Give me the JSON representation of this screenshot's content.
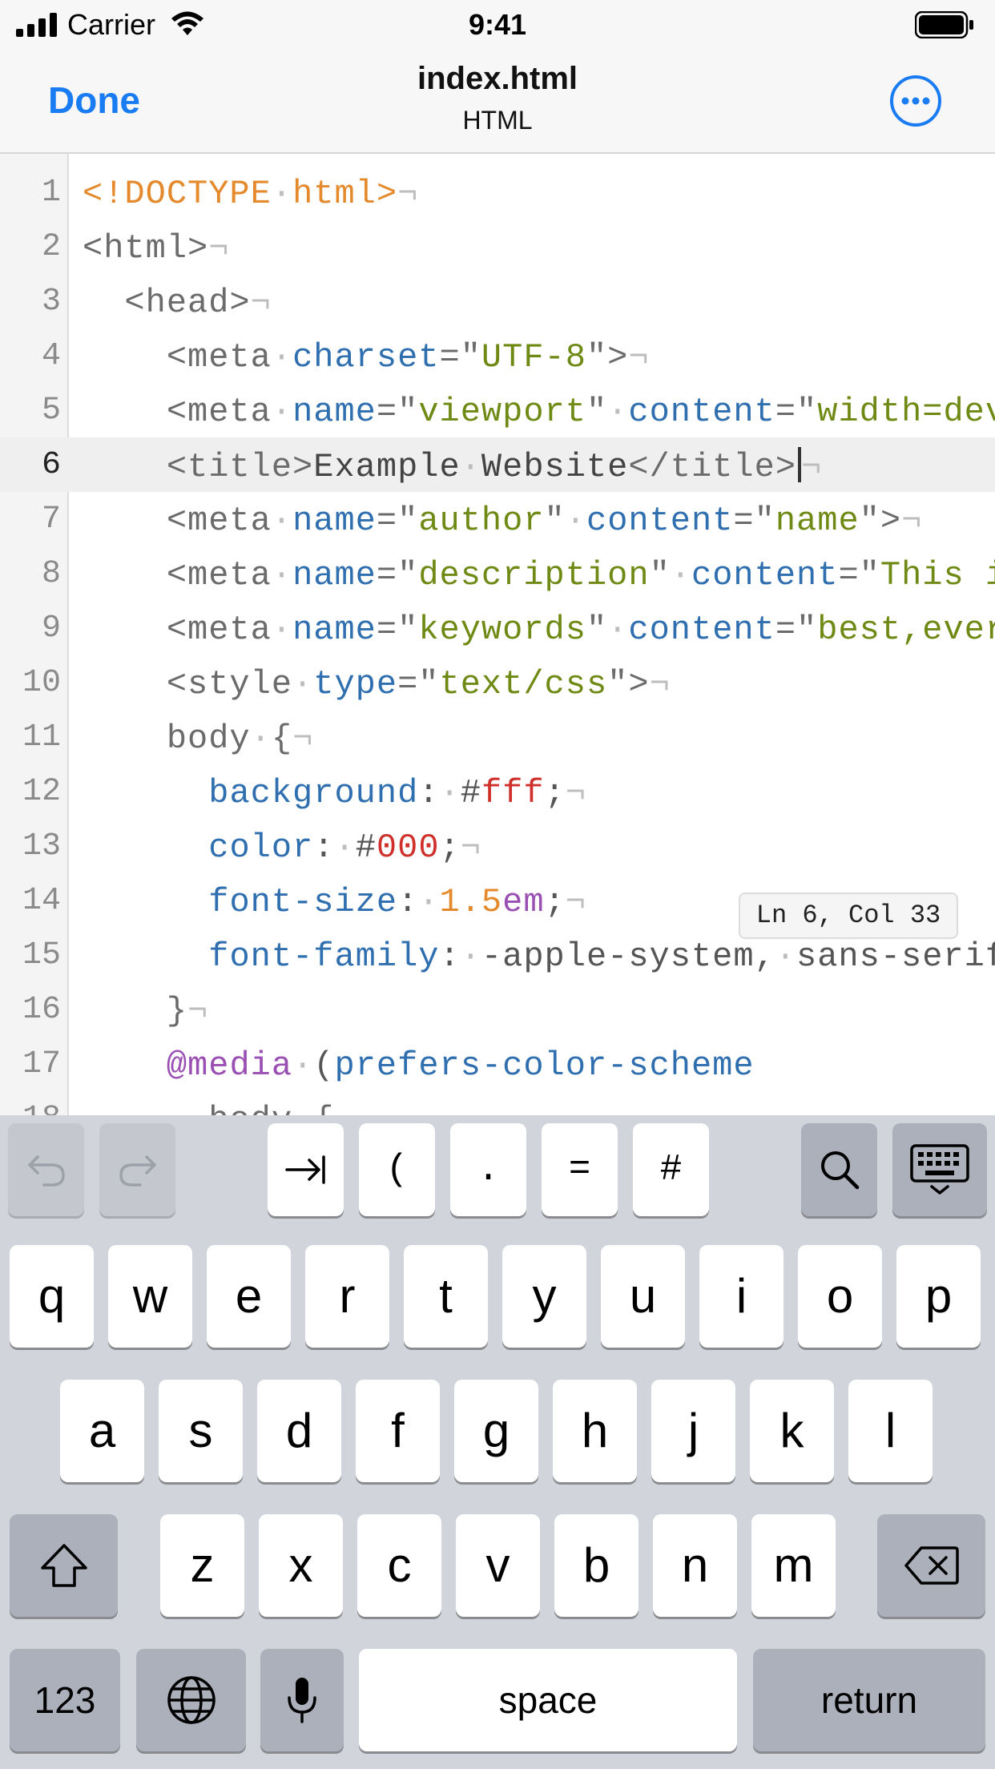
{
  "status_bar": {
    "carrier": "Carrier",
    "time": "9:41"
  },
  "nav": {
    "done_label": "Done",
    "title": "index.html",
    "subtitle": "HTML",
    "accent": "#1a7cf2"
  },
  "editor": {
    "current_line": 6,
    "line_numbers": [
      "1",
      "2",
      "3",
      "4",
      "5",
      "6",
      "7",
      "8",
      "9",
      "10",
      "11",
      "12",
      "13",
      "14",
      "15",
      "16",
      "17",
      "18"
    ],
    "position": "Ln 6, Col 33",
    "lines": [
      [
        [
          "doc",
          "<!DOCTYPE"
        ],
        [
          "inv",
          "·"
        ],
        [
          "doc",
          "html>"
        ],
        [
          "inv",
          "¬"
        ]
      ],
      [
        [
          "tag",
          "<html>"
        ],
        [
          "inv",
          "¬"
        ]
      ],
      [
        [
          "tag",
          "  <head>"
        ],
        [
          "inv",
          "¬"
        ]
      ],
      [
        [
          "tag",
          "    <meta"
        ],
        [
          "inv",
          "·"
        ],
        [
          "attr",
          "charset"
        ],
        [
          "tag",
          "=\""
        ],
        [
          "str",
          "UTF-8"
        ],
        [
          "tag",
          "\">"
        ],
        [
          "inv",
          "¬"
        ]
      ],
      [
        [
          "tag",
          "    <meta"
        ],
        [
          "inv",
          "·"
        ],
        [
          "attr",
          "name"
        ],
        [
          "tag",
          "=\""
        ],
        [
          "str",
          "viewport"
        ],
        [
          "tag",
          "\""
        ],
        [
          "inv",
          "·"
        ],
        [
          "attr",
          "content"
        ],
        [
          "tag",
          "=\""
        ],
        [
          "str",
          "width=devi"
        ]
      ],
      [
        [
          "tag",
          "    <title>"
        ],
        [
          "txt",
          "Example"
        ],
        [
          "inv",
          "·"
        ],
        [
          "txt",
          "Website"
        ],
        [
          "tag",
          "</title>"
        ],
        [
          "caret",
          ""
        ],
        [
          "inv",
          "¬"
        ]
      ],
      [
        [
          "tag",
          "    <meta"
        ],
        [
          "inv",
          "·"
        ],
        [
          "attr",
          "name"
        ],
        [
          "tag",
          "=\""
        ],
        [
          "str",
          "author"
        ],
        [
          "tag",
          "\""
        ],
        [
          "inv",
          "·"
        ],
        [
          "attr",
          "content"
        ],
        [
          "tag",
          "=\""
        ],
        [
          "str",
          "name"
        ],
        [
          "tag",
          "\">"
        ],
        [
          "inv",
          "¬"
        ]
      ],
      [
        [
          "tag",
          "    <meta"
        ],
        [
          "inv",
          "·"
        ],
        [
          "attr",
          "name"
        ],
        [
          "tag",
          "=\""
        ],
        [
          "str",
          "description"
        ],
        [
          "tag",
          "\""
        ],
        [
          "inv",
          "·"
        ],
        [
          "attr",
          "content"
        ],
        [
          "tag",
          "=\""
        ],
        [
          "str",
          "This is"
        ]
      ],
      [
        [
          "tag",
          "    <meta"
        ],
        [
          "inv",
          "·"
        ],
        [
          "attr",
          "name"
        ],
        [
          "tag",
          "=\""
        ],
        [
          "str",
          "keywords"
        ],
        [
          "tag",
          "\""
        ],
        [
          "inv",
          "·"
        ],
        [
          "attr",
          "content"
        ],
        [
          "tag",
          "=\""
        ],
        [
          "str",
          "best,ever"
        ]
      ],
      [
        [
          "tag",
          "    <style"
        ],
        [
          "inv",
          "·"
        ],
        [
          "attr",
          "type"
        ],
        [
          "tag",
          "=\""
        ],
        [
          "str",
          "text/css"
        ],
        [
          "tag",
          "\">"
        ],
        [
          "inv",
          "¬"
        ]
      ],
      [
        [
          "tag",
          "    body"
        ],
        [
          "inv",
          "·"
        ],
        [
          "tag",
          "{"
        ],
        [
          "inv",
          "¬"
        ]
      ],
      [
        [
          "plain",
          "      "
        ],
        [
          "prop",
          "background"
        ],
        [
          "plain",
          ":"
        ],
        [
          "inv",
          "·"
        ],
        [
          "plain",
          "#"
        ],
        [
          "red",
          "fff"
        ],
        [
          "plain",
          ";"
        ],
        [
          "inv",
          "¬"
        ]
      ],
      [
        [
          "plain",
          "      "
        ],
        [
          "prop",
          "color"
        ],
        [
          "plain",
          ":"
        ],
        [
          "inv",
          "·"
        ],
        [
          "plain",
          "#"
        ],
        [
          "red",
          "000"
        ],
        [
          "plain",
          ";"
        ],
        [
          "inv",
          "¬"
        ]
      ],
      [
        [
          "plain",
          "      "
        ],
        [
          "prop",
          "font-size"
        ],
        [
          "plain",
          ":"
        ],
        [
          "inv",
          "·"
        ],
        [
          "num",
          "1.5"
        ],
        [
          "unit",
          "em"
        ],
        [
          "plain",
          ";"
        ],
        [
          "inv",
          "¬"
        ]
      ],
      [
        [
          "plain",
          "      "
        ],
        [
          "prop",
          "font-family"
        ],
        [
          "plain",
          ":"
        ],
        [
          "inv",
          "·"
        ],
        [
          "plain",
          "-apple-system,"
        ],
        [
          "inv",
          "·"
        ],
        [
          "plain",
          "sans-serif"
        ]
      ],
      [
        [
          "tag",
          "    }"
        ],
        [
          "inv",
          "¬"
        ]
      ],
      [
        [
          "plain",
          "    "
        ],
        [
          "at",
          "@media"
        ],
        [
          "inv",
          "·"
        ],
        [
          "plain",
          "("
        ],
        [
          "prop",
          "prefers-color-scheme"
        ]
      ],
      [
        [
          "tag",
          "      body"
        ],
        [
          "inv",
          "·"
        ],
        [
          "tag",
          "{"
        ],
        [
          "inv",
          "¬"
        ]
      ]
    ]
  },
  "keyboard": {
    "accessory": [
      "→|",
      "(",
      ".",
      "=",
      "#"
    ],
    "row1": [
      "q",
      "w",
      "e",
      "r",
      "t",
      "y",
      "u",
      "i",
      "o",
      "p"
    ],
    "row2": [
      "a",
      "s",
      "d",
      "f",
      "g",
      "h",
      "j",
      "k",
      "l"
    ],
    "row3": [
      "z",
      "x",
      "c",
      "v",
      "b",
      "n",
      "m"
    ],
    "numbers_label": "123",
    "space_label": "space",
    "return_label": "return"
  }
}
